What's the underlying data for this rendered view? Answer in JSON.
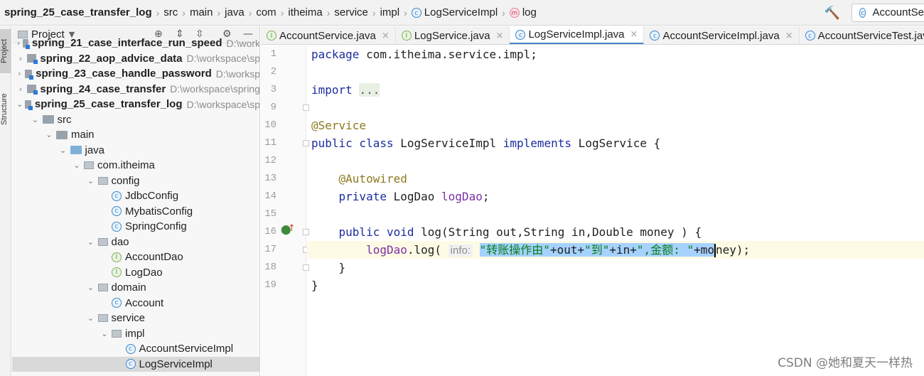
{
  "breadcrumb": {
    "items": [
      "spring_25_case_transfer_log",
      "src",
      "main",
      "java",
      "com",
      "itheima",
      "service",
      "impl",
      "LogServiceImpl",
      "log"
    ]
  },
  "toolbar": {
    "run_config": "AccountSe"
  },
  "tool_windows": {
    "project": "Project",
    "structure": "Structure"
  },
  "project_panel": {
    "title": "Project",
    "tree": [
      {
        "label": "spring_21_case_interface_run_speed",
        "path": "D:\\work",
        "kind": "module",
        "depth": 0,
        "arrow": "right"
      },
      {
        "label": "spring_22_aop_advice_data",
        "path": "D:\\workspace\\sp",
        "kind": "module",
        "depth": 0,
        "arrow": "right"
      },
      {
        "label": "spring_23_case_handle_password",
        "path": "D:\\worksp",
        "kind": "module",
        "depth": 0,
        "arrow": "right"
      },
      {
        "label": "spring_24_case_transfer",
        "path": "D:\\workspace\\spring",
        "kind": "module",
        "depth": 0,
        "arrow": "right"
      },
      {
        "label": "spring_25_case_transfer_log",
        "path": "D:\\workspace\\sp",
        "kind": "module",
        "depth": 0,
        "arrow": "down"
      },
      {
        "label": "src",
        "path": "",
        "kind": "folder",
        "depth": 1,
        "arrow": "down"
      },
      {
        "label": "main",
        "path": "",
        "kind": "folder",
        "depth": 2,
        "arrow": "down"
      },
      {
        "label": "java",
        "path": "",
        "kind": "source",
        "depth": 3,
        "arrow": "down"
      },
      {
        "label": "com.itheima",
        "path": "",
        "kind": "package",
        "depth": 4,
        "arrow": "down"
      },
      {
        "label": "config",
        "path": "",
        "kind": "package",
        "depth": 5,
        "arrow": "down"
      },
      {
        "label": "JdbcConfig",
        "path": "",
        "kind": "class",
        "depth": 6,
        "arrow": ""
      },
      {
        "label": "MybatisConfig",
        "path": "",
        "kind": "class",
        "depth": 6,
        "arrow": ""
      },
      {
        "label": "SpringConfig",
        "path": "",
        "kind": "class",
        "depth": 6,
        "arrow": ""
      },
      {
        "label": "dao",
        "path": "",
        "kind": "package",
        "depth": 5,
        "arrow": "down"
      },
      {
        "label": "AccountDao",
        "path": "",
        "kind": "interface",
        "depth": 6,
        "arrow": ""
      },
      {
        "label": "LogDao",
        "path": "",
        "kind": "interface",
        "depth": 6,
        "arrow": ""
      },
      {
        "label": "domain",
        "path": "",
        "kind": "package",
        "depth": 5,
        "arrow": "down"
      },
      {
        "label": "Account",
        "path": "",
        "kind": "class",
        "depth": 6,
        "arrow": ""
      },
      {
        "label": "service",
        "path": "",
        "kind": "package",
        "depth": 5,
        "arrow": "down"
      },
      {
        "label": "impl",
        "path": "",
        "kind": "package",
        "depth": 6,
        "arrow": "down"
      },
      {
        "label": "AccountServiceImpl",
        "path": "",
        "kind": "class",
        "depth": 7,
        "arrow": ""
      },
      {
        "label": "LogServiceImpl",
        "path": "",
        "kind": "class",
        "depth": 7,
        "arrow": "",
        "selected": true
      }
    ]
  },
  "editor_tabs": [
    {
      "label": "AccountService.java",
      "icon": "I",
      "active": false
    },
    {
      "label": "LogService.java",
      "icon": "I",
      "active": false
    },
    {
      "label": "LogServiceImpl.java",
      "icon": "C",
      "active": true
    },
    {
      "label": "AccountServiceImpl.java",
      "icon": "C",
      "active": false
    },
    {
      "label": "AccountServiceTest.java",
      "icon": "C",
      "active": false
    }
  ],
  "code": {
    "line_numbers": [
      "1",
      "2",
      "3",
      "9",
      "10",
      "11",
      "12",
      "13",
      "14",
      "15",
      "16",
      "17",
      "18",
      "19"
    ],
    "package_kw": "package",
    "package_name": " com.itheima.service.impl;",
    "import_kw": "import",
    "import_fold": "...",
    "service_ann": "@Service",
    "class_decl_kw1": "public class",
    "class_decl_name": " LogServiceImpl ",
    "class_decl_kw2": "implements",
    "class_decl_rest": " LogService {",
    "autowired_ann": "@Autowired",
    "field_kw": "private",
    "field_type": " LogDao ",
    "field_name": "logDao",
    "field_end": ";",
    "method_kw": "public void",
    "method_rest": " log(String out,String in,Double money ) {",
    "call_obj": "logDao",
    "call_rest": ".log( ",
    "param_hint": "info:",
    "sel_part1": "\"转账操作由\"",
    "sel_part2": "+out+",
    "sel_part3": "\"到\"",
    "sel_part4": "+in+",
    "sel_part5": "\",金额: \"",
    "sel_part6": "+mo",
    "after_cursor": "ney);",
    "close_method": "}",
    "close_class": "}"
  },
  "watermark": "CSDN @她和夏天一样热",
  "colors": {
    "keyword": "#1b2d9e",
    "annotation": "#8b7a1e",
    "field": "#7b2fa7",
    "selection": "#a6d2ff",
    "active_tab_underline": "#4a88c7"
  }
}
